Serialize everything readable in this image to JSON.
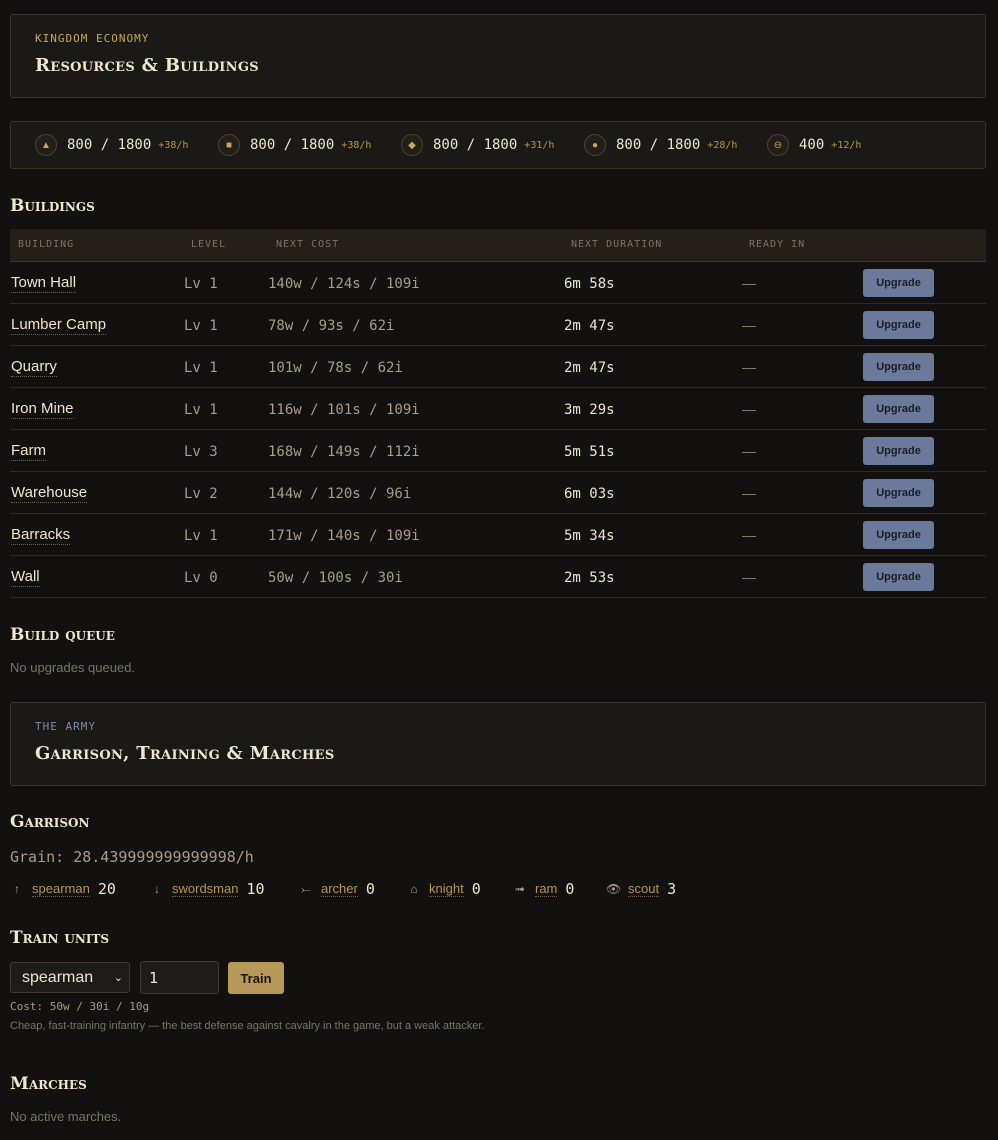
{
  "economy": {
    "eyebrow": "KINGDOM ECONOMY",
    "title": "Resources & Buildings",
    "eyebrow_color": "#c9a65a"
  },
  "resources": [
    {
      "icon": "▲",
      "icon_name": "wood-icon",
      "value": "800 / 1800",
      "rate": "+38/h"
    },
    {
      "icon": "■",
      "icon_name": "stone-icon",
      "value": "800 / 1800",
      "rate": "+38/h"
    },
    {
      "icon": "◆",
      "icon_name": "iron-icon",
      "value": "800 / 1800",
      "rate": "+31/h"
    },
    {
      "icon": "●",
      "icon_name": "grain-icon",
      "value": "800 / 1800",
      "rate": "+28/h"
    },
    {
      "icon": "⊖",
      "icon_name": "gold-icon",
      "value": "400",
      "rate": "+12/h"
    }
  ],
  "buildings": {
    "heading": "Buildings",
    "columns": [
      "BUILDING",
      "LEVEL",
      "NEXT COST",
      "NEXT DURATION",
      "READY IN"
    ],
    "upgrade_label": "Upgrade",
    "rows": [
      {
        "name": "Town Hall",
        "level": "Lv 1",
        "cost": "140w / 124s / 109i",
        "duration": "6m 58s",
        "ready": "—"
      },
      {
        "name": "Lumber Camp",
        "level": "Lv 1",
        "cost": "78w / 93s / 62i",
        "duration": "2m 47s",
        "ready": "—"
      },
      {
        "name": "Quarry",
        "level": "Lv 1",
        "cost": "101w / 78s / 62i",
        "duration": "2m 47s",
        "ready": "—"
      },
      {
        "name": "Iron Mine",
        "level": "Lv 1",
        "cost": "116w / 101s / 109i",
        "duration": "3m 29s",
        "ready": "—"
      },
      {
        "name": "Farm",
        "level": "Lv 3",
        "cost": "168w / 149s / 112i",
        "duration": "5m 51s",
        "ready": "—"
      },
      {
        "name": "Warehouse",
        "level": "Lv 2",
        "cost": "144w / 120s / 96i",
        "duration": "6m 03s",
        "ready": "—"
      },
      {
        "name": "Barracks",
        "level": "Lv 1",
        "cost": "171w / 140s / 109i",
        "duration": "5m 34s",
        "ready": "—"
      },
      {
        "name": "Wall",
        "level": "Lv 0",
        "cost": "50w / 100s / 30i",
        "duration": "2m 53s",
        "ready": "—"
      }
    ]
  },
  "build_queue": {
    "heading": "Build queue",
    "empty": "No upgrades queued."
  },
  "army": {
    "eyebrow": "THE ARMY",
    "title": "Garrison, Training & Marches",
    "eyebrow_color": "#7a8aaa"
  },
  "garrison": {
    "heading": "Garrison",
    "grain": "Grain: 28.439999999999998/h",
    "units": [
      {
        "icon": "↑",
        "icon_name": "spear-icon",
        "name": "spearman",
        "count": "20"
      },
      {
        "icon": "↓",
        "icon_name": "sword-icon",
        "name": "swordsman",
        "count": "10"
      },
      {
        "icon": "⤚",
        "icon_name": "bow-icon",
        "name": "archer",
        "count": "0"
      },
      {
        "icon": "⌂",
        "icon_name": "helmet-icon",
        "name": "knight",
        "count": "0"
      },
      {
        "icon": "➟",
        "icon_name": "ram-icon",
        "name": "ram",
        "count": "0"
      },
      {
        "icon": "👁",
        "icon_name": "eye-icon",
        "name": "scout",
        "count": "3"
      }
    ]
  },
  "train": {
    "heading": "Train units",
    "selected_unit": "spearman",
    "quantity": "1",
    "button": "Train",
    "cost": "Cost: 50w / 30i / 10g",
    "description": "Cheap, fast-training infantry — the best defense against cavalry in the game, but a weak attacker."
  },
  "marches": {
    "heading": "Marches",
    "empty": "No active marches."
  }
}
